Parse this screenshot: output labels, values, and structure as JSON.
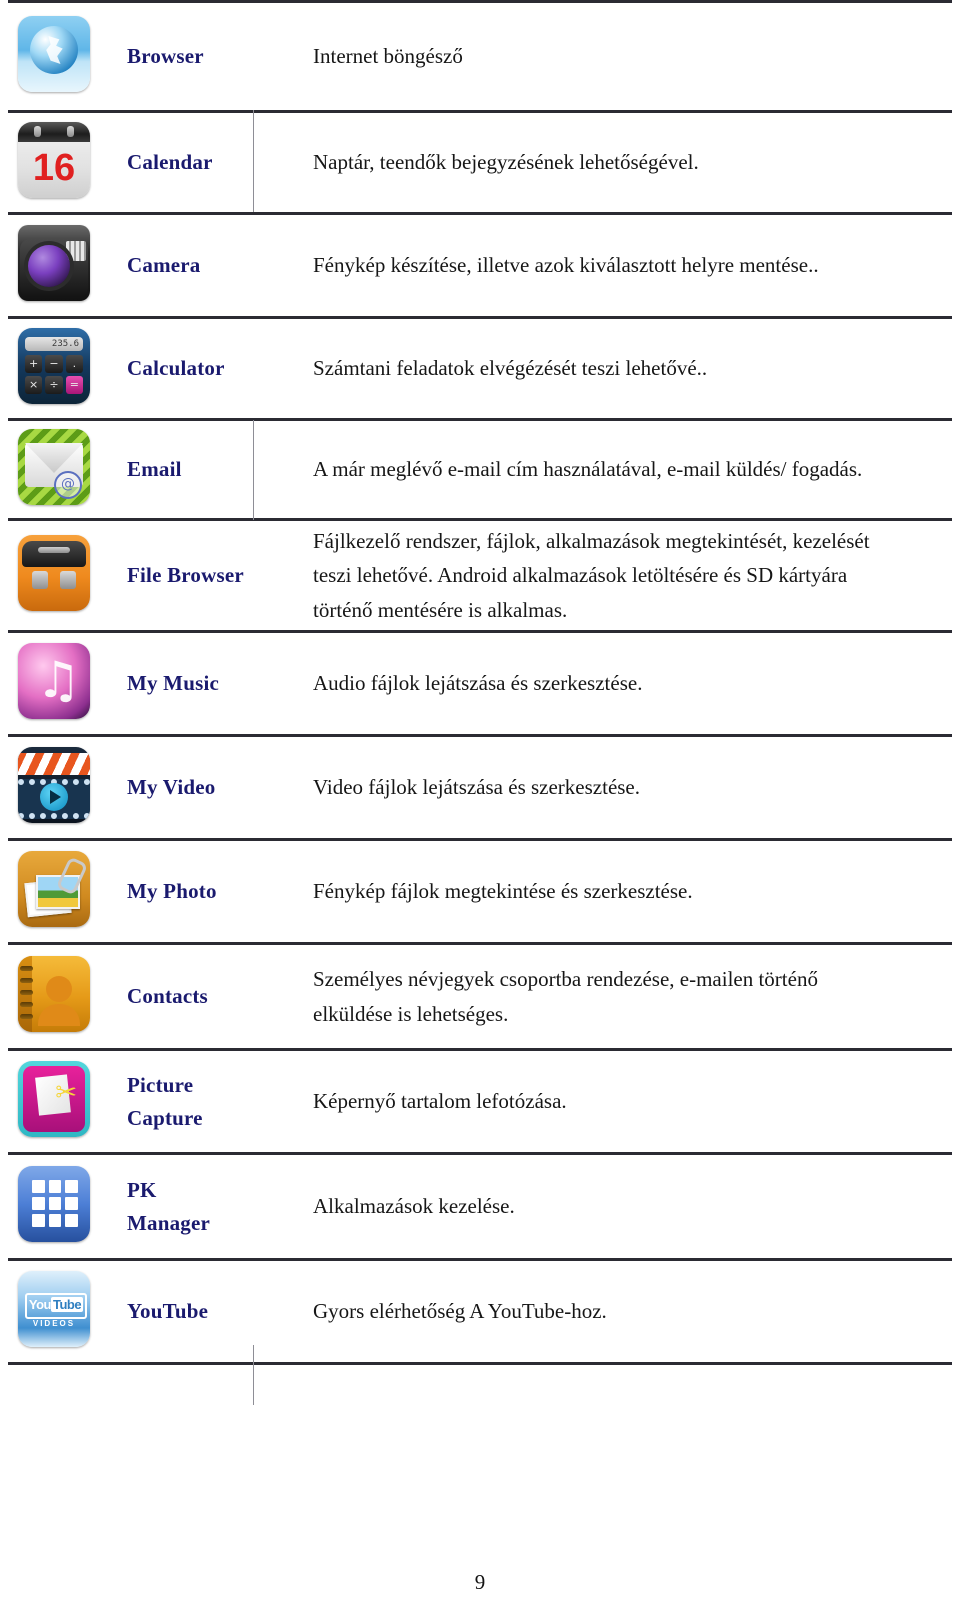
{
  "document": {
    "page_number": "9",
    "name_color": "#1a1a6e",
    "text_color": "#161616",
    "rule_color": "#2b2b33"
  },
  "table": {
    "rows": [
      {
        "icon": "browser-globe-icon",
        "name": "Browser",
        "desc_lines": [
          "Internet böngésző"
        ]
      },
      {
        "icon": "calendar-icon",
        "icon_text": "16",
        "name": "Calendar",
        "desc_lines": [
          "Naptár, teendők bejegyzésének lehetőségével."
        ]
      },
      {
        "icon": "camera-icon",
        "name": "Camera",
        "desc_lines": [
          "Fénykép készítése, illetve azok kiválasztott helyre mentése.."
        ]
      },
      {
        "icon": "calculator-icon",
        "icon_text": "235.6",
        "name": "Calculator",
        "desc_lines": [
          "Számtani feladatok elvégézését teszi lehetővé.."
        ]
      },
      {
        "icon": "email-envelope-icon",
        "name": "Email",
        "desc_lines": [
          "A már meglévő e-mail cím használatával, e-mail küldés/ fogadás."
        ]
      },
      {
        "icon": "file-browser-bag-icon",
        "name": "File Browser",
        "desc_lines": [
          "Fájlkezelő rendszer, fájlok, alkalmazások megtekintését, kezelését",
          "teszi lehetővé. Android alkalmazások letöltésére és SD kártyára",
          "történő mentésére is alkalmas."
        ]
      },
      {
        "icon": "music-note-icon",
        "name": "My Music",
        "desc_lines": [
          "Audio fájlok lejátszása és szerkesztése."
        ]
      },
      {
        "icon": "video-clapper-icon",
        "name": "My Video",
        "desc_lines": [
          "Video fájlok lejátszása és szerkesztése."
        ]
      },
      {
        "icon": "photo-stack-icon",
        "name": "My Photo",
        "desc_lines": [
          "Fénykép fájlok megtekintése és szerkesztése."
        ]
      },
      {
        "icon": "contacts-book-icon",
        "name": "Contacts",
        "desc_lines": [
          "Személyes névjegyek csoportba rendezése, e-mailen történő",
          "elküldése is lehetséges."
        ]
      },
      {
        "icon": "picture-capture-icon",
        "name": "Picture\nCapture",
        "desc_lines": [
          "Képernyő tartalom lefotózása."
        ]
      },
      {
        "icon": "pk-manager-grid-icon",
        "name": "PK\nManager",
        "desc_lines": [
          "Alkalmazások kezelése."
        ]
      },
      {
        "icon": "youtube-icon",
        "icon_text": "VIDEOS",
        "name": "YouTube",
        "desc_lines": [
          "Gyors elérhetőség A YouTube-hoz."
        ]
      }
    ]
  }
}
